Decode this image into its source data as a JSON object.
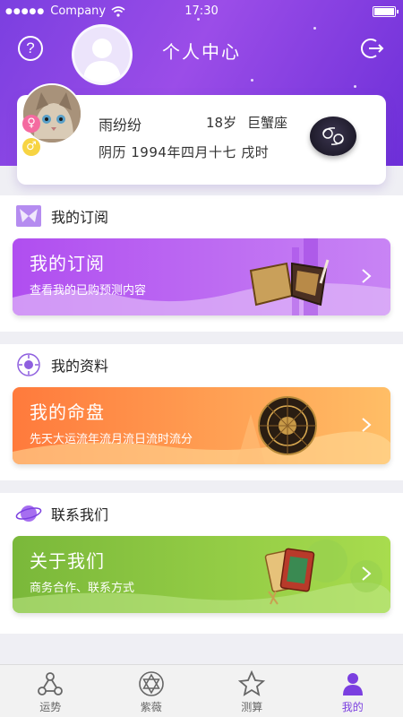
{
  "status_bar": {
    "carrier": "Company",
    "time": "17:30"
  },
  "header": {
    "title": "个人中心"
  },
  "profile": {
    "name": "雨纷纷",
    "age": "18岁",
    "zodiac_sign": "巨蟹座",
    "lunar_birthday": "阴历 1994年四月十七 戌时",
    "gender_female_symbol": "♀",
    "gender_male_symbol": "♂"
  },
  "sections": [
    {
      "title": "我的订阅",
      "banner_title": "我的订阅",
      "banner_subtitle": "查看我的已购预测内容",
      "icon": "butterfly-icon"
    },
    {
      "title": "我的资料",
      "banner_title": "我的命盘",
      "banner_subtitle": "先天大运流年流月流日流时流分",
      "icon": "sun-icon"
    },
    {
      "title": "联系我们",
      "banner_title": "关于我们",
      "banner_subtitle": "商务合作、联系方式",
      "icon": "planet-icon"
    }
  ],
  "tabbar": {
    "tabs": [
      {
        "label": "运势",
        "icon": "network-icon",
        "active": false
      },
      {
        "label": "紫薇",
        "icon": "star-of-david-icon",
        "active": false
      },
      {
        "label": "测算",
        "icon": "star-icon",
        "active": false
      },
      {
        "label": "我的",
        "icon": "person-icon",
        "active": true
      }
    ]
  },
  "colors": {
    "header_purple": "#7b3fe0",
    "subscription_gradient": "#b04ef0",
    "chart_gradient": "#ff8a4c",
    "about_gradient": "#7cc63a",
    "active_tab": "#7b3fe0"
  }
}
